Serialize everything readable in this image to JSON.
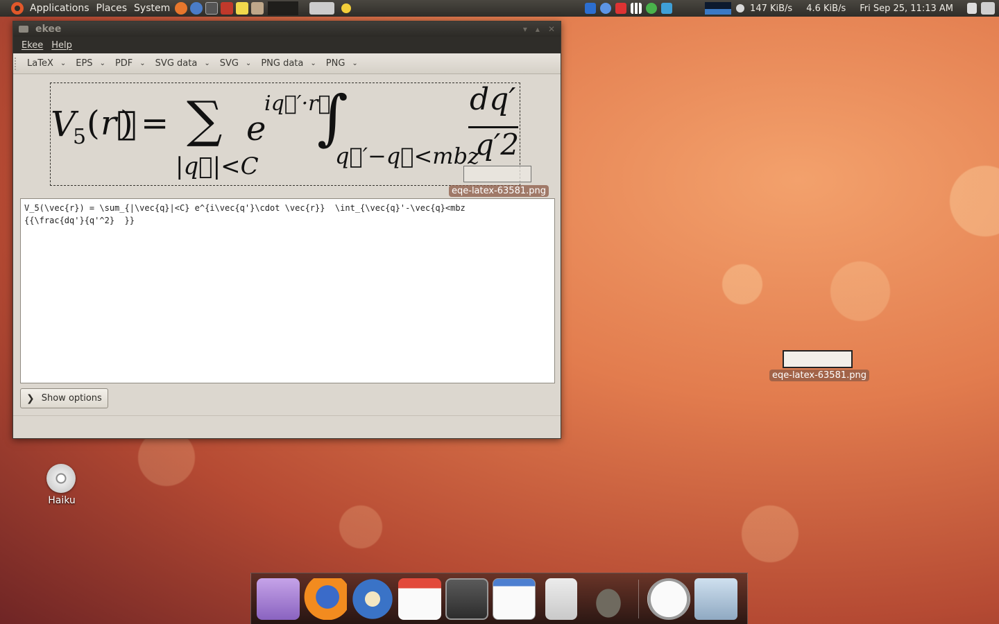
{
  "panel": {
    "menus": [
      "Applications",
      "Places",
      "System"
    ],
    "net_down": "147 KiB/s",
    "net_up": "4.6 KiB/s",
    "clock": "Fri Sep 25, 11:13 AM"
  },
  "window": {
    "title": "ekee",
    "menu": [
      "Ekee",
      "Help"
    ],
    "toolbar": [
      "LaTeX",
      "EPS",
      "PDF",
      "SVG data",
      "SVG",
      "PNG data",
      "PNG"
    ],
    "source_text": "V_5(\\vec{r}) = \\sum_{|\\vec{q}|<C} e^{i\\vec{q'}\\cdot \\vec{r}}  \\int_{\\vec{q}'-\\vec{q}<mbz\n{{\\frac{dq'}{q'^2}  }}",
    "show_options": "Show options",
    "drag_filename": "eqe-latex-63581.png"
  },
  "desktop": {
    "file_label": "eqe-latex-63581.png",
    "haiku_label": "Haiku"
  },
  "equation": {
    "lhs": "V",
    "sub5": "5",
    "lparen": "(",
    "rvec": "r⃗",
    "rparen": ")",
    "equals": "=",
    "sigma": "∑",
    "sum_sub": "|q⃗|<C",
    "e": "e",
    "exp": "iq⃗′·r⃗",
    "integral": "∫",
    "int_sub": "q⃗′−q⃗<mbz",
    "num": "dq′",
    "den": "q′2"
  },
  "colors": {
    "panel": "#3b3934",
    "window_bg": "#dcd7cf",
    "wallpaper_core": "#e27c4e"
  }
}
